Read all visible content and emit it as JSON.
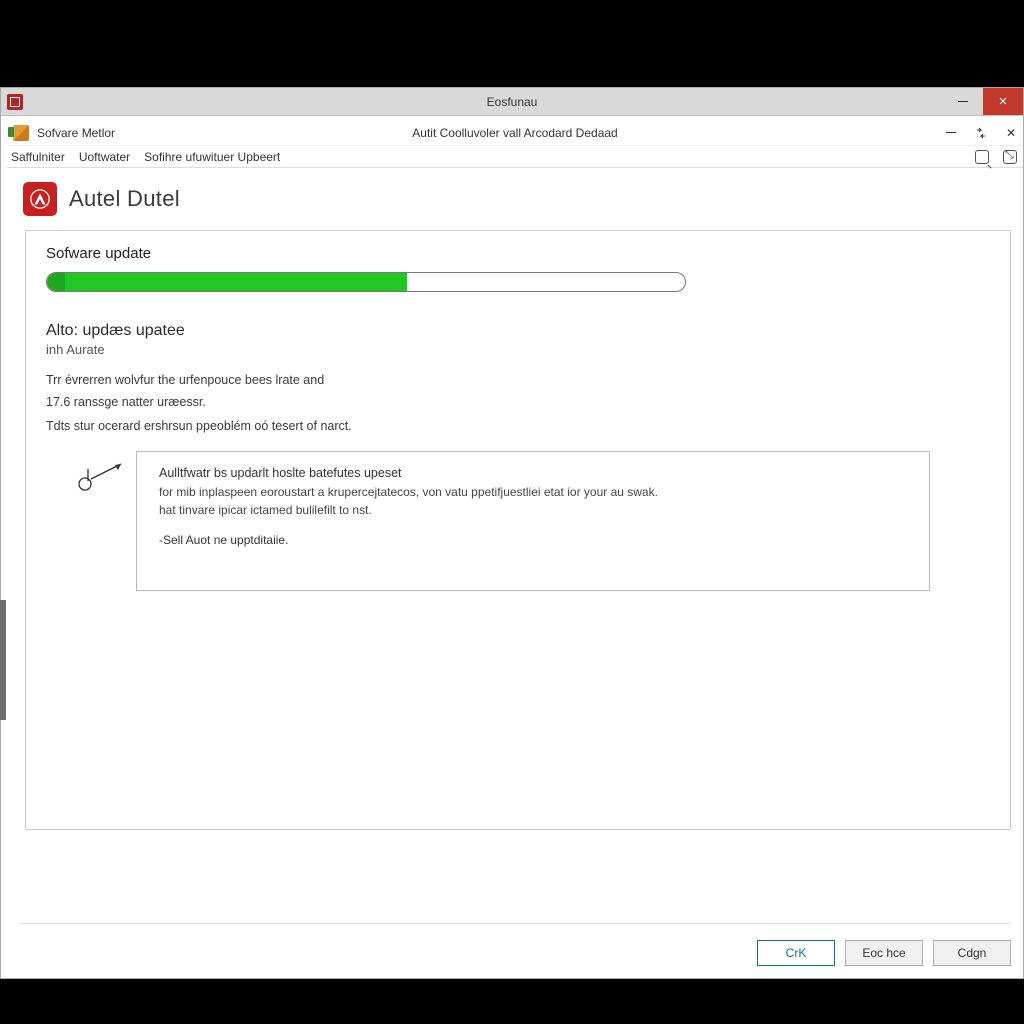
{
  "outer": {
    "title": "Eosfunau"
  },
  "inner": {
    "left_title": "Sofvare Metlor",
    "center_title": "Autit Coolluvoler vall Arcodard Dedaad"
  },
  "menu": {
    "items": [
      "Saffulniter",
      "Uoftwater",
      "Sofihre ufuwituer Upbeert"
    ]
  },
  "brand": {
    "name": "Autel Dutel"
  },
  "progress": {
    "label": "Sofware update",
    "percent": 55
  },
  "updates": {
    "heading": "Alto: updæs upatee",
    "subheading": "inh Aurate",
    "lines": [
      "Trr évrerren wolvfur the urfenpouce bees lrate and",
      "17.6 ranssge natter uræessr.",
      "Tdts stur ocerard ershrsun ppeoblém oó tesert of narct."
    ]
  },
  "infobox": {
    "title": "Aulltfwatr bs updarlt hoslte batefutes upeset",
    "body1": "for mib inplaspeen eoroustart a krupercejtatecos, von vatu ppetifjuestliei etat ior your au swak.",
    "body2": "hat tinvare ipicar ictamed bulilefilt to nst.",
    "bullet": "-Sell Auot ne upptditaiie."
  },
  "buttons": {
    "ok": "CrK",
    "back": "Eoc hce",
    "cancel": "Cdgn"
  }
}
